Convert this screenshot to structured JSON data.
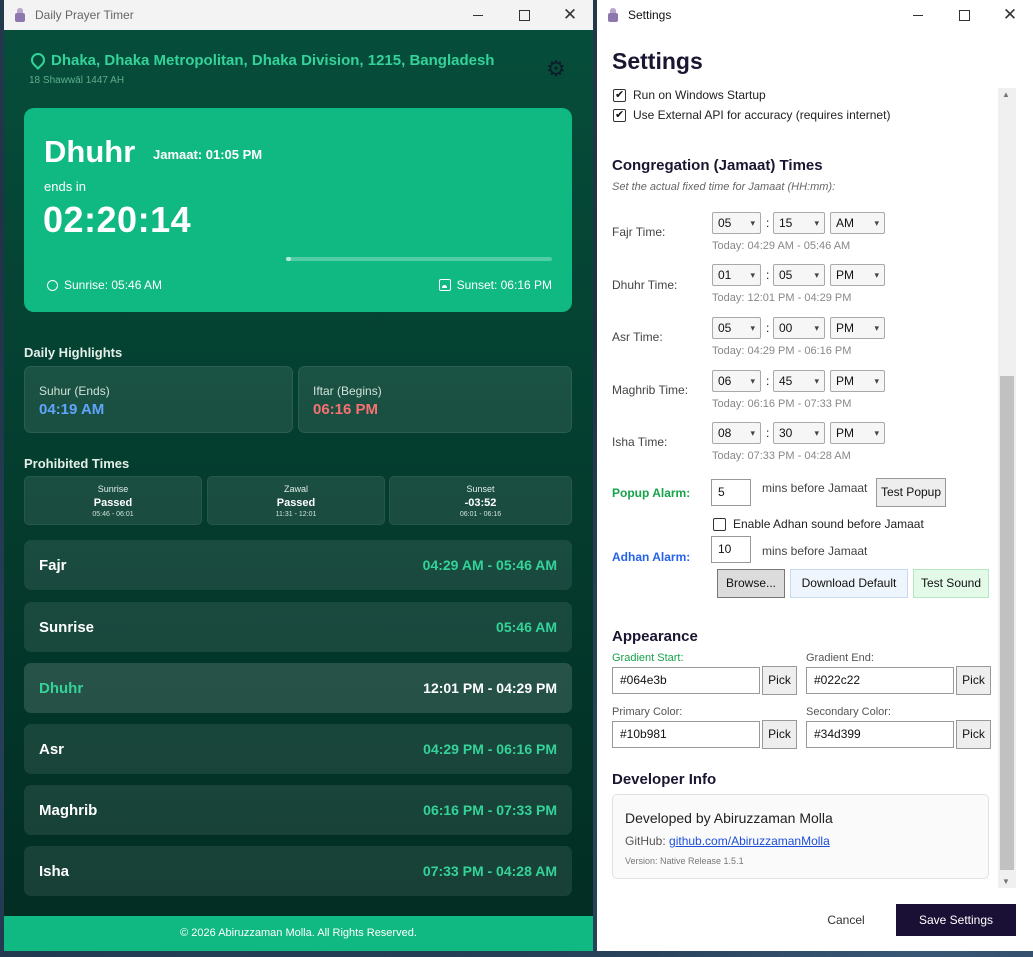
{
  "left_window": {
    "title": "Daily Prayer Timer",
    "location": "Dhaka, Dhaka Metropolitan, Dhaka Division, 1215, Bangladesh",
    "hijri_date": "18 Shawwāl 1447 AH",
    "hero": {
      "current_prayer": "Dhuhr",
      "jamaat": "Jamaat: 01:05 PM",
      "ends_label": "ends in",
      "countdown": "02:20:14",
      "progress_percent": 2,
      "sunrise": "Sunrise: 05:46 AM",
      "sunset": "Sunset: 06:16 PM",
      "colors": {
        "card": "#10b981"
      }
    },
    "highlights": {
      "title": "Daily Highlights",
      "suhur_label": "Suhur (Ends)",
      "suhur_time": "04:19 AM",
      "iftar_label": "Iftar (Begins)",
      "iftar_time": "06:16 PM"
    },
    "prohibited": {
      "title": "Prohibited Times",
      "items": [
        {
          "name": "Sunrise",
          "status": "Passed",
          "range": "05:46 - 06:01"
        },
        {
          "name": "Zawal",
          "status": "Passed",
          "range": "11:31 - 12:01"
        },
        {
          "name": "Sunset",
          "status": "-03:52",
          "range": "06:01 - 06:16"
        }
      ]
    },
    "prayers": [
      {
        "name": "Fajr",
        "time": "04:29 AM - 05:46 AM",
        "active": false
      },
      {
        "name": "Sunrise",
        "time": "05:46 AM",
        "active": false
      },
      {
        "name": "Dhuhr",
        "time": "12:01 PM - 04:29 PM",
        "active": true
      },
      {
        "name": "Asr",
        "time": "04:29 PM - 06:16 PM",
        "active": false
      },
      {
        "name": "Maghrib",
        "time": "06:16 PM - 07:33 PM",
        "active": false
      },
      {
        "name": "Isha",
        "time": "07:33 PM - 04:28 AM",
        "active": false
      }
    ],
    "footer": "© 2026 Abiruzzaman Molla. All Rights Reserved."
  },
  "settings": {
    "title": "Settings",
    "heading": "Settings",
    "checkboxes": {
      "startup_label": "Run on Windows Startup",
      "startup_checked": true,
      "api_label": "Use External API for accuracy (requires internet)",
      "api_checked": true
    },
    "jamaat": {
      "heading": "Congregation (Jamaat) Times",
      "subtitle": "Set the actual fixed time for Jamaat (HH:mm):",
      "rows": [
        {
          "label": "Fajr Time:",
          "hour": "05",
          "minute": "15",
          "ampm": "AM",
          "range": "Today: 04:29 AM - 05:46 AM"
        },
        {
          "label": "Dhuhr Time:",
          "hour": "01",
          "minute": "05",
          "ampm": "PM",
          "range": "Today: 12:01 PM - 04:29 PM"
        },
        {
          "label": "Asr Time:",
          "hour": "05",
          "minute": "00",
          "ampm": "PM",
          "range": "Today: 04:29 PM - 06:16 PM"
        },
        {
          "label": "Maghrib Time:",
          "hour": "06",
          "minute": "45",
          "ampm": "PM",
          "range": "Today: 06:16 PM - 07:33 PM"
        },
        {
          "label": "Isha Time:",
          "hour": "08",
          "minute": "30",
          "ampm": "PM",
          "range": "Today: 07:33 PM - 04:28 AM"
        }
      ]
    },
    "alarms": {
      "popup_label": "Popup Alarm:",
      "popup_value": "5",
      "popup_suffix": "mins before Jamaat",
      "test_popup": "Test Popup",
      "adhan_checkbox_label": "Enable Adhan sound before Jamaat",
      "adhan_checkbox_checked": false,
      "adhan_label": "Adhan Alarm:",
      "adhan_value": "10",
      "adhan_suffix": "mins before Jamaat",
      "browse": "Browse...",
      "download_default": "Download Default",
      "test_sound": "Test Sound"
    },
    "appearance": {
      "heading": "Appearance",
      "gradient_start_label": "Gradient Start:",
      "gradient_start": "#064e3b",
      "gradient_end_label": "Gradient End:",
      "gradient_end": "#022c22",
      "primary_label": "Primary Color:",
      "primary": "#10b981",
      "secondary_label": "Secondary Color:",
      "secondary": "#34d399",
      "pick": "Pick",
      "gradient_start_label_color": "#16a34a",
      "other_label_color": "#555555"
    },
    "developer": {
      "heading": "Developer Info",
      "name": "Developed by Abiruzzaman Molla",
      "github_label": "GitHub:",
      "github_link": "github.com/AbiruzzamanMolla",
      "version": "Version: Native Release 1.5.1"
    },
    "cancel": "Cancel",
    "save": "Save Settings"
  }
}
